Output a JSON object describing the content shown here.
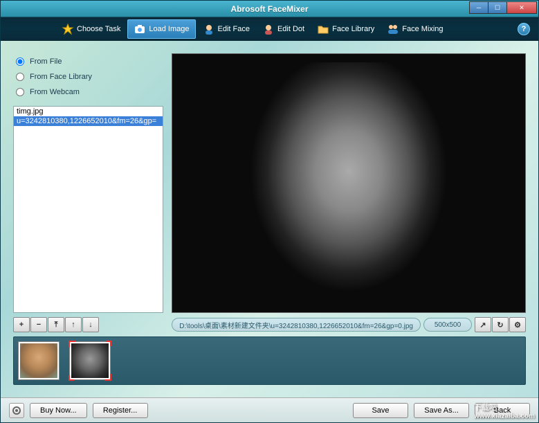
{
  "app": {
    "title": "Abrosoft FaceMixer"
  },
  "toolbar": {
    "choose_task": "Choose Task",
    "load_image": "Load Image",
    "edit_face": "Edit Face",
    "edit_dot": "Edit Dot",
    "face_library": "Face Library",
    "face_mixing": "Face Mixing"
  },
  "source": {
    "from_file": "From File",
    "from_face_library": "From Face Library",
    "from_webcam": "From Webcam",
    "selected": "file"
  },
  "files": [
    {
      "name": "timg.jpg",
      "selected": false
    },
    {
      "name": "u=3242810380,1226652010&fm=26&gp=",
      "selected": true
    }
  ],
  "list_controls": {
    "add": "+",
    "remove": "−",
    "top": "⤒",
    "up": "↑",
    "down": "↓"
  },
  "path": {
    "value": "D:\\tools\\桌面\\素材新建文件夹\\u=3242810380,1226652010&fm=26&gp=0.jpg",
    "dimensions": "500x500"
  },
  "path_controls": {
    "zoom_fit": "↗",
    "refresh": "↻",
    "settings": "⚙"
  },
  "bottom": {
    "buy": "Buy Now...",
    "register": "Register...",
    "save": "Save",
    "save_as": "Save As...",
    "back": "Back"
  },
  "watermark": {
    "main": "下载吧",
    "sub": "www.xiazaiba.com"
  }
}
